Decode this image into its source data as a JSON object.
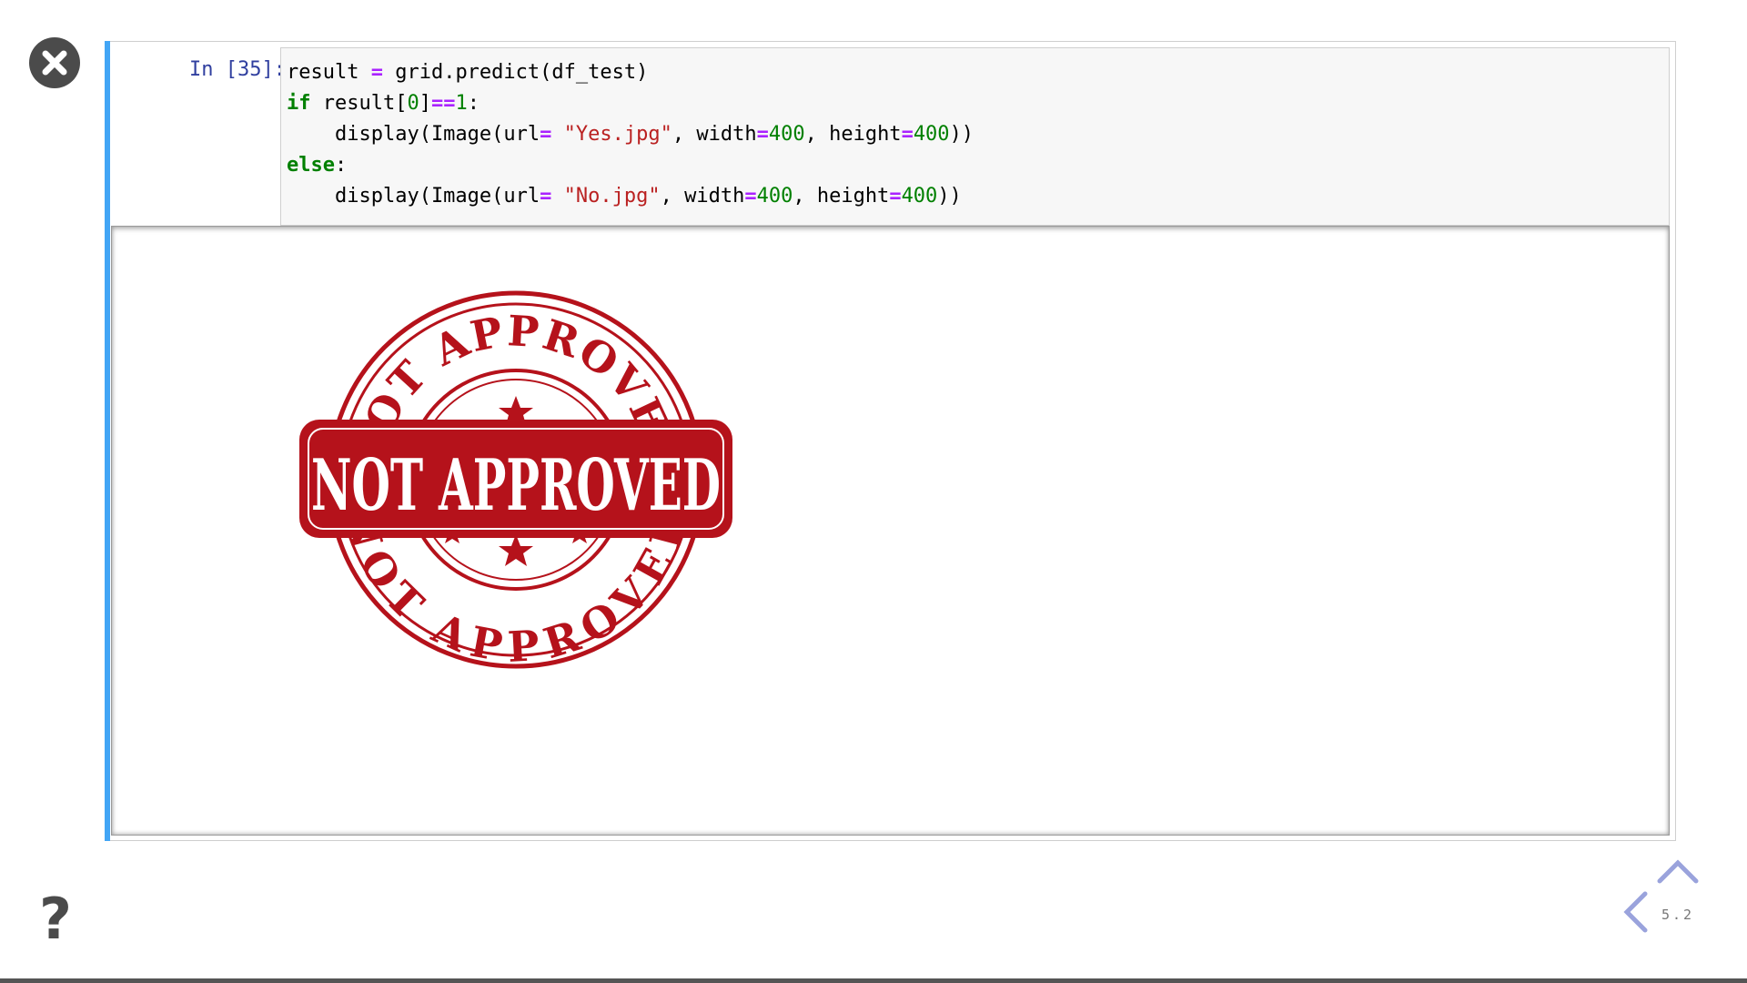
{
  "cell": {
    "prompt": "In [35]:",
    "code": [
      [
        [
          "t",
          "result "
        ],
        [
          "op",
          "="
        ],
        [
          "t",
          " grid.predict(df_test)"
        ]
      ],
      [
        [
          "kw",
          "if"
        ],
        [
          "t",
          " result["
        ],
        [
          "num",
          "0"
        ],
        [
          "t",
          "]"
        ],
        [
          "op",
          "=="
        ],
        [
          "num",
          "1"
        ],
        [
          "t",
          ":"
        ]
      ],
      [
        [
          "t",
          "    display(Image(url"
        ],
        [
          "op",
          "="
        ],
        [
          "t",
          " "
        ],
        [
          "str",
          "\"Yes.jpg\""
        ],
        [
          "t",
          ", width"
        ],
        [
          "op",
          "="
        ],
        [
          "num",
          "400"
        ],
        [
          "t",
          ", height"
        ],
        [
          "op",
          "="
        ],
        [
          "num",
          "400"
        ],
        [
          "t",
          "))"
        ]
      ],
      [
        [
          "kw",
          "else"
        ],
        [
          "t",
          ":"
        ]
      ],
      [
        [
          "t",
          "    display(Image(url"
        ],
        [
          "op",
          "="
        ],
        [
          "t",
          " "
        ],
        [
          "str",
          "\"No.jpg\""
        ],
        [
          "t",
          ", width"
        ],
        [
          "op",
          "="
        ],
        [
          "num",
          "400"
        ],
        [
          "t",
          ", height"
        ],
        [
          "op",
          "="
        ],
        [
          "num",
          "400"
        ],
        [
          "t",
          "))"
        ]
      ]
    ]
  },
  "output": {
    "stamp_text_banner": "NOT APPROVED",
    "stamp_text_ring_top": "NOT APPROVED",
    "stamp_text_ring_bottom": "NOT APPROVED",
    "stamp_color": "#b5121b"
  },
  "nav": {
    "slide_number": "5.2"
  },
  "icons": {
    "close": "close-icon",
    "help": "question-icon",
    "up": "chevron-up-icon",
    "left": "chevron-left-icon"
  },
  "colors": {
    "cell_accent": "#42a5f5",
    "prompt": "#303f9f",
    "keyword": "#008000",
    "operator": "#aa22ff",
    "string": "#ba2121",
    "nav": "#9aa3dc"
  }
}
